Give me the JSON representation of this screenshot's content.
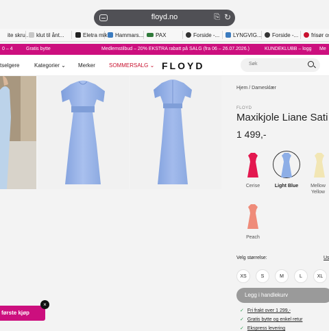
{
  "browser": {
    "url": "floyd.no",
    "bookmarks": [
      {
        "label": "ite skru...",
        "color": "#ffffff"
      },
      {
        "label": "klut til ånt...",
        "color": "#c7c7c7"
      },
      {
        "label": "Eletra mik...",
        "color": "#222222"
      },
      {
        "label": "Hammars...",
        "color": "#3b7bbf"
      },
      {
        "label": "PAX",
        "color": "#2f7a3a"
      },
      {
        "label": "Forside -...",
        "color": "#333333"
      },
      {
        "label": "LYNGVIG...",
        "color": "#3b7bbf"
      },
      {
        "label": "Forside -...",
        "color": "#333333"
      },
      {
        "label": "frisør os",
        "color": "#c8102e"
      }
    ]
  },
  "promo": {
    "left": "0 – 4",
    "gratis": "Gratis bytte",
    "center": "Medlemstilbud  –  20% EKSTRA rabatt på SALG (fra 06 – 26.07.2026.)",
    "club": "KUNDEKLUBB – logg",
    "right": "Me"
  },
  "nav": {
    "items": [
      "tselgere",
      "Kategorier",
      "Merker",
      "SOMMERSALG"
    ],
    "logo": "FLOYD",
    "search_placeholder": "Søk",
    "accent": "#c8102e"
  },
  "product": {
    "breadcrumb": "Hjem  /  Damesklær",
    "brand": "FLOYD",
    "title": "Maxikjole Liane Sati",
    "price": "1 499,-",
    "colors": [
      {
        "label": "Cerise",
        "color": "#e3184f",
        "selected": false
      },
      {
        "label": "Light Blue",
        "color": "#8daee6",
        "selected": true
      },
      {
        "label": "Mellow Yellow",
        "color": "#f2e6b4",
        "selected": false
      },
      {
        "label": "Peach",
        "color": "#ef8b79",
        "selected": false
      }
    ],
    "size_header": "Velg størrelse:",
    "size_guide": "Us",
    "sizes": [
      "XS",
      "S",
      "M",
      "L",
      "XL"
    ],
    "add_to_cart": "Legg i handlekurv",
    "perks": [
      "Fri frakt over 1 299,-",
      "Gratis bytte og enkel retur",
      "Ekspress levering"
    ]
  },
  "popup": {
    "label": "første kjøp",
    "close": "×"
  }
}
